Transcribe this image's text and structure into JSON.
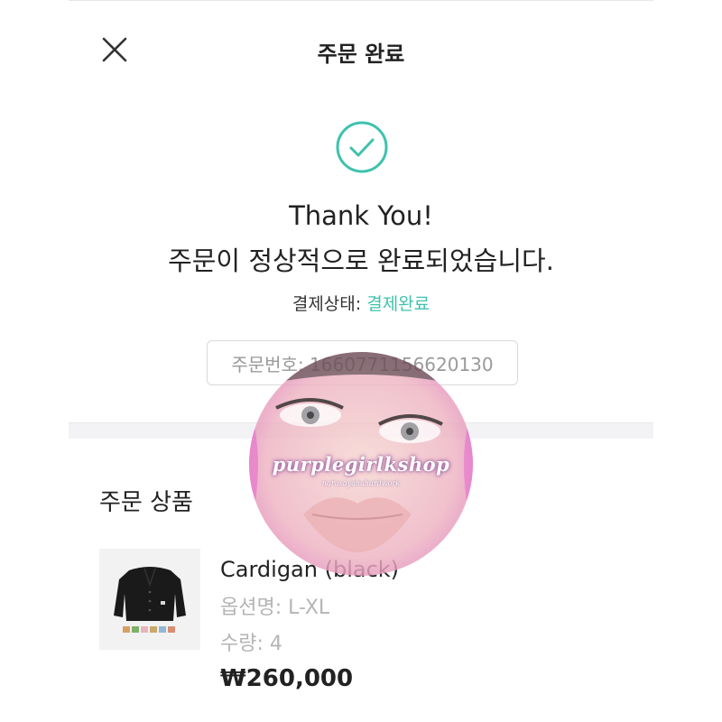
{
  "header": {
    "title": "주문 완료",
    "close_icon": "close-icon"
  },
  "success": {
    "icon": "check-circle-icon",
    "accent_color": "#3fc2ac",
    "title": "Thank You!",
    "message": "주문이 정상적으로 완료되었습니다."
  },
  "payment": {
    "label": "결제상태: ",
    "value": "결제완료"
  },
  "order": {
    "number_text": "주문번호: 16607711566201​30"
  },
  "products_section": {
    "title": "주문 상품",
    "items": [
      {
        "name": "Cardigan (black)",
        "option": "옵션명: L-XL",
        "quantity": "수량: 4",
        "price": "₩260,000"
      }
    ]
  },
  "watermark": {
    "text": "purplegirlkshop",
    "subtext": "narusayahahardwork"
  }
}
